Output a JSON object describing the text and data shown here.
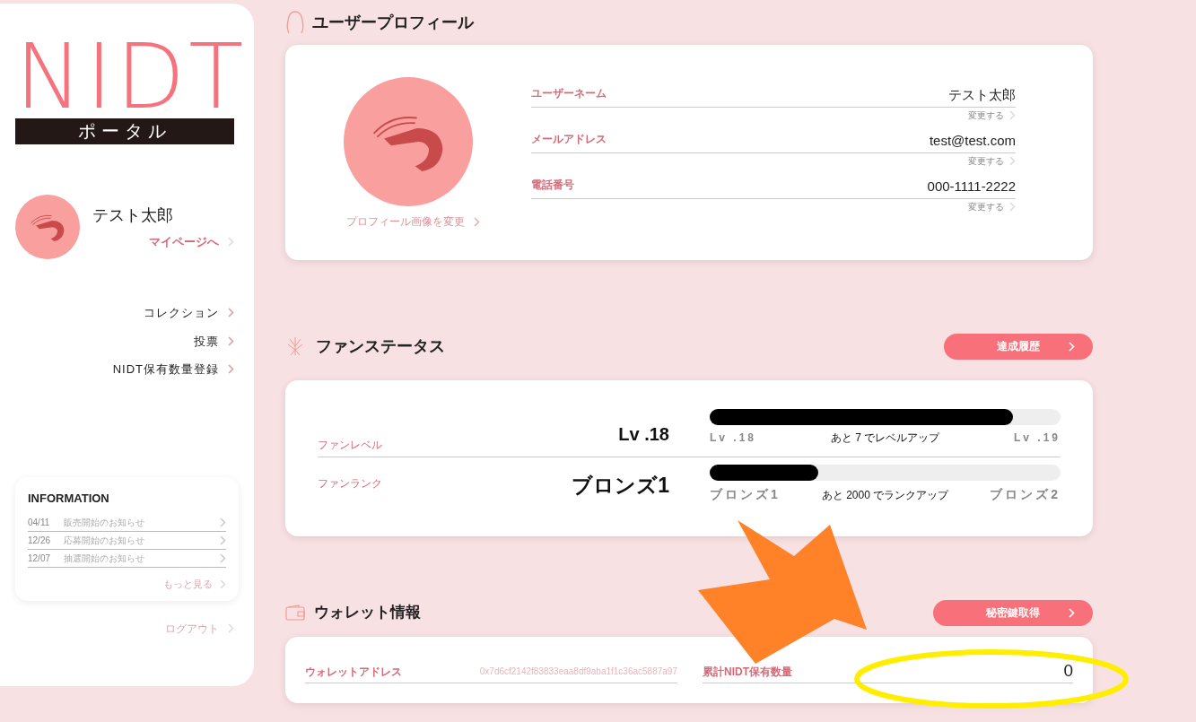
{
  "sidebar": {
    "logo": {
      "title": "NIDT",
      "subtitle": "ポータル"
    },
    "user": {
      "name": "テスト太郎",
      "link": "マイページへ"
    },
    "nav": [
      {
        "label": "コレクション"
      },
      {
        "label": "投票"
      },
      {
        "label": "NIDT保有数量登録"
      }
    ],
    "information": {
      "title": "INFORMATION",
      "items": [
        {
          "date": "04/11",
          "text": "販売開始のお知らせ"
        },
        {
          "date": "12/26",
          "text": "応募開始のお知らせ"
        },
        {
          "date": "12/07",
          "text": "抽選開始のお知らせ"
        }
      ],
      "more": "もっと見る"
    },
    "logout": "ログアウト"
  },
  "profile": {
    "title": "ユーザープロフィール",
    "change_image": "プロフィール画像を変更",
    "fields": [
      {
        "label": "ユーザーネーム",
        "value": "テスト太郎",
        "action": "変更する"
      },
      {
        "label": "メールアドレス",
        "value": "test@test.com",
        "action": "変更する"
      },
      {
        "label": "電話番号",
        "value": "000-1111-2222",
        "action": "変更する"
      }
    ]
  },
  "fan_status": {
    "title": "ファンステータス",
    "button": "達成履歴",
    "rows": [
      {
        "label": "ファンレベル",
        "value": "Lv .18",
        "level": 0.865,
        "from": "Lv .18",
        "note": "あと 7 でレベルアップ",
        "to": "Lv .19"
      },
      {
        "label": "ファンランク",
        "value": "ブロンズ1",
        "level": 0.31,
        "from": "ブロンズ1",
        "note": "あと 2000 でランクアップ",
        "to": "ブロンズ2"
      }
    ]
  },
  "wallet": {
    "title": "ウォレット情報",
    "button": "秘密鍵取得",
    "address_label": "ウォレットアドレス",
    "address": "0x7d6cf2142f83833eaa8df9aba1f1c36ac5887a97",
    "total_label": "累計NIDT保有数量",
    "total": "0"
  }
}
